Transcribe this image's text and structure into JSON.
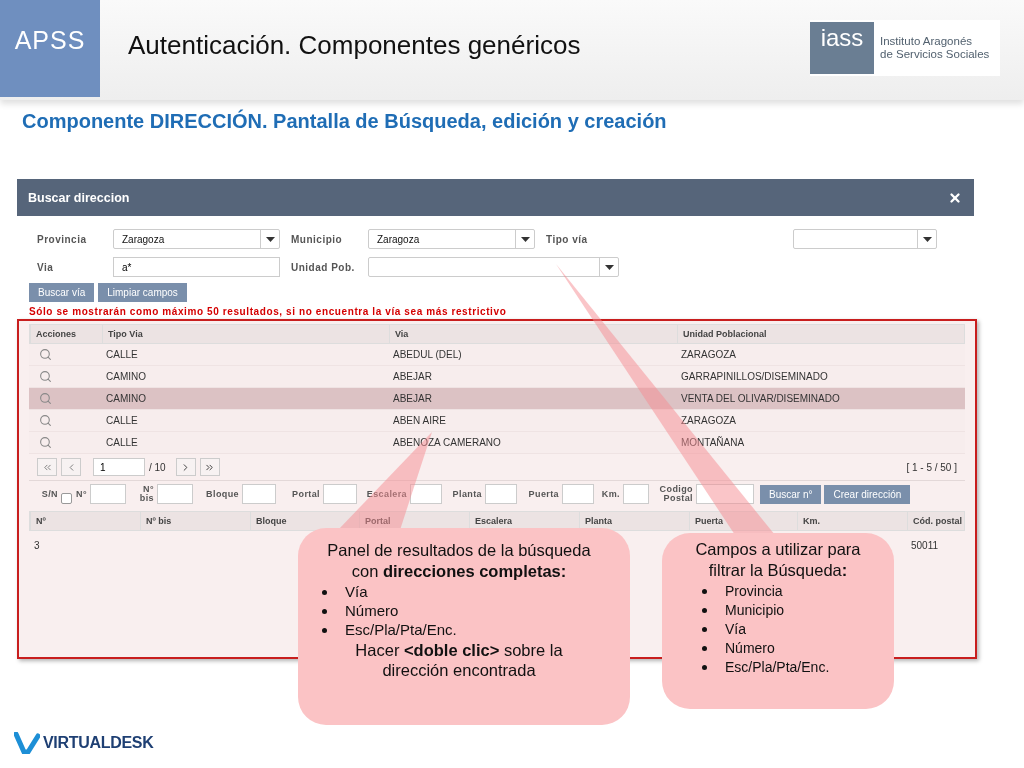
{
  "header": {
    "badge": "APSS",
    "title": "Autenticación. Componentes genéricos",
    "logo": {
      "mark": "iass",
      "lines": [
        "Instituto Aragonés",
        "de Servicios Sociales"
      ]
    }
  },
  "subtitle": "Componente DIRECCIÓN. Pantalla de Búsqueda, edición y creación",
  "dialog": {
    "title": "Buscar direccion",
    "filter_rows": [
      {
        "fields": [
          {
            "label": "Provincia",
            "kind": "select",
            "value": "Zaragoza"
          },
          {
            "label": "Municipio",
            "kind": "select",
            "value": "Zaragoza"
          },
          {
            "label": "Tipo vía",
            "kind": "select"
          }
        ]
      },
      {
        "fields": [
          {
            "label": "Via",
            "kind": "text",
            "value": "a*"
          },
          {
            "label": "Unidad Pob.",
            "kind": "select"
          }
        ]
      }
    ],
    "buttons": [
      "Buscar vía",
      "Limpiar campos"
    ],
    "warning": "Sólo se mostrarán como máximo 50 resultados, si no encuentra la vía sea más restrictivo",
    "results": {
      "columns": [
        "Acciones",
        "Tipo Via",
        "Via",
        "Unidad Poblacional"
      ],
      "rows": [
        {
          "tipo": "CALLE",
          "via": "ABEDUL (DEL)",
          "unidad": "ZARAGOZA",
          "selected": false
        },
        {
          "tipo": "CAMINO",
          "via": "ABEJAR",
          "unidad": "GARRAPINILLOS/DISEMINADO",
          "selected": false
        },
        {
          "tipo": "CAMINO",
          "via": "ABEJAR",
          "unidad": "VENTA DEL OLIVAR/DISEMINADO",
          "selected": true
        },
        {
          "tipo": "CALLE",
          "via": "ABEN AIRE",
          "unidad": "ZARAGOZA",
          "selected": false
        },
        {
          "tipo": "CALLE",
          "via": "ABENOZA CAMERANO",
          "unidad": "MONTAÑANA",
          "selected": false
        }
      ],
      "pager": {
        "page": "1",
        "total": "/ 10",
        "range": "[ 1 - 5 / 50 ]"
      }
    },
    "number_filters": {
      "sn": {
        "label": "S/N",
        "checked": false
      },
      "fields": [
        {
          "label": "N°"
        },
        {
          "label": "N° bis"
        },
        {
          "label": "Bloque"
        },
        {
          "label": "Portal"
        },
        {
          "label": "Escalera"
        },
        {
          "label": "Planta"
        },
        {
          "label": "Puerta"
        },
        {
          "label": "Km."
        },
        {
          "label": "Codigo Postal"
        }
      ],
      "buttons": [
        "Buscar n°",
        "Crear dirección"
      ]
    },
    "addresses": {
      "columns": [
        {
          "label": "Nº",
          "cells": [
            "3"
          ]
        },
        {
          "label": "Nº bis"
        },
        {
          "label": "Bloque"
        },
        {
          "label": "Portal"
        },
        {
          "label": "Escalera"
        },
        {
          "label": "Planta"
        },
        {
          "label": "Puerta"
        },
        {
          "label": "Km."
        },
        {
          "label": "Cód. postal",
          "cells": [
            "50011"
          ]
        }
      ]
    }
  },
  "callouts": [
    {
      "intro": "Panel de resultados de la búsqueda con **direcciones completas:**",
      "bullets": [
        "Vía",
        "Número",
        "Esc/Pla/Pta/Enc."
      ],
      "outro": "Hacer **<doble clic>** sobre la dirección encontrada"
    },
    {
      "intro": "Campos a utilizar para filtrar la Búsqueda**:**",
      "bullets": [
        "Provincia",
        "Municipio",
        "Vía",
        "Número",
        "Esc/Pla/Pta/Enc."
      ]
    }
  ],
  "footer": {
    "brand": "VIRTUALDESK"
  }
}
